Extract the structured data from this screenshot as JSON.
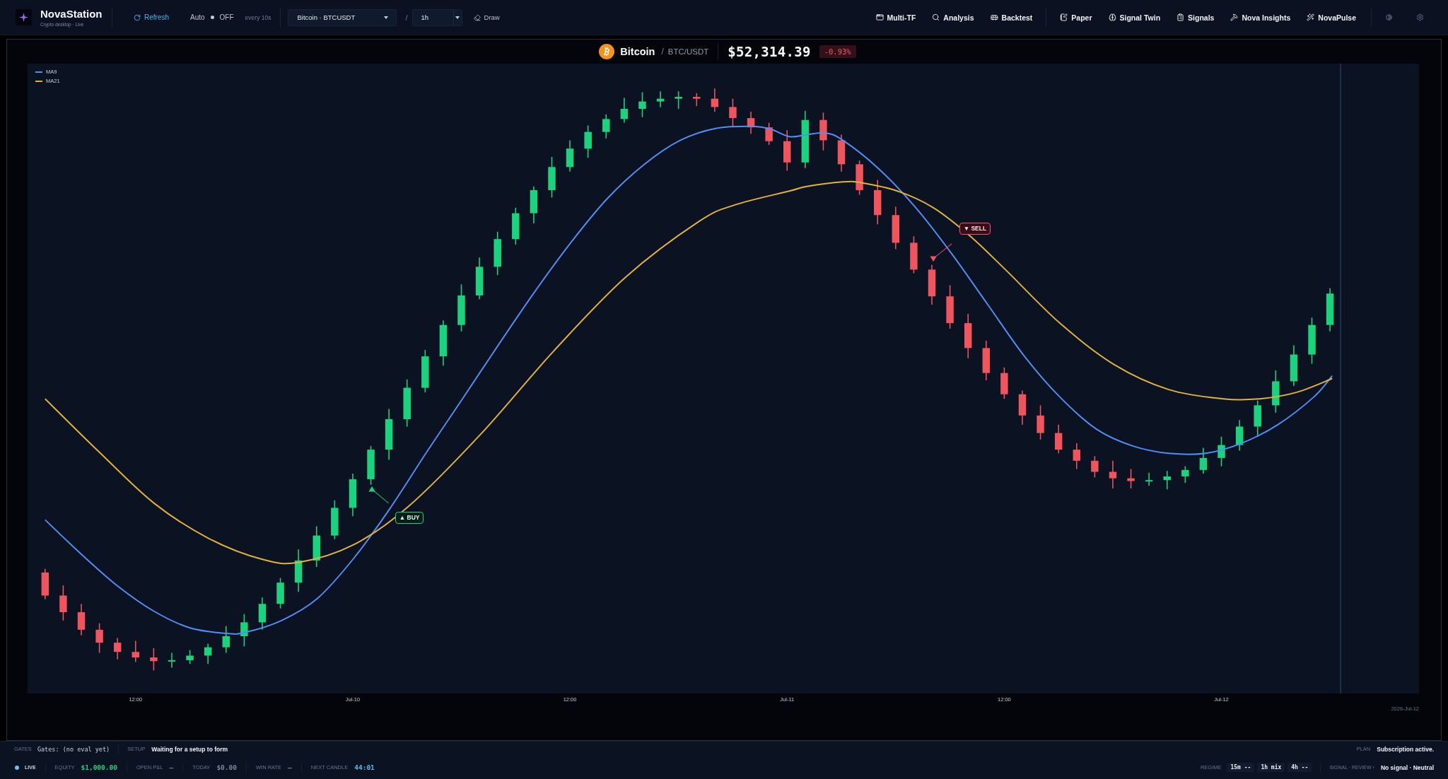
{
  "app": {
    "name": "NovaStation",
    "subtitle": "Crypto desktop · Live"
  },
  "toolbar": {
    "refresh": "Refresh",
    "auto_refresh": {
      "label": "Auto",
      "on": false,
      "state": "OFF"
    },
    "interval": "every 10s",
    "symbol_select": {
      "value": "Bitcoin · BTCUSDT"
    },
    "separator": "/",
    "timeframe_select": {
      "value": "1h"
    },
    "draw": "Draw"
  },
  "nav": {
    "groups": [
      {
        "items": [
          "Multi-TF",
          "Analysis",
          "Backtest"
        ]
      },
      {
        "items": [
          "Paper",
          "Signal Twin",
          "Signals",
          "Nova Insights",
          "NovaPulse"
        ]
      }
    ]
  },
  "header": {
    "coin": "Bitcoin",
    "separator": "/",
    "pair": "BTC/USDT",
    "price": "$52,314.39",
    "change": "-0.93%",
    "negative": true
  },
  "chart": {
    "legend": [
      {
        "label": "MA9",
        "color": "#4f8ff7"
      },
      {
        "label": "MA21",
        "color": "#e2b33c"
      }
    ],
    "signals": [
      {
        "kind": "buy",
        "label": "▲ BUY"
      },
      {
        "kind": "sell",
        "label": "▼ SELL"
      }
    ],
    "x_labels": [
      "12:00",
      "Jul-10",
      "12:00",
      "Jul-11",
      "12:00",
      "Jul-12"
    ],
    "date": "2026-Jul-12"
  },
  "status": {
    "top": {
      "gates": {
        "label": "GATES",
        "value": "Gates: (no eval yet)"
      },
      "setup": {
        "label": "SETUP",
        "value": "Waiting for a setup to form"
      },
      "plan": {
        "label": "PLAN",
        "value": "Subscription active."
      }
    },
    "bottom": {
      "live": {
        "label": "LIVE",
        "on": true
      },
      "metrics": [
        {
          "label": "EQUITY",
          "value": "$1,000.00",
          "color": "#1fd17f"
        },
        {
          "label": "OPEN P&L",
          "value": "—",
          "color": "#7d889a"
        },
        {
          "label": "TODAY",
          "value": "$0.00",
          "color": "#7d889a"
        },
        {
          "label": "WIN RATE",
          "value": "—",
          "color": "#7d889a"
        },
        {
          "label": "NEXT CANDLE",
          "value": "44:01",
          "color": "#49c0ee"
        }
      ],
      "regime": {
        "label": "REGIME",
        "chips": [
          "15m --",
          "1h mix",
          "4h --"
        ]
      },
      "signal_review": {
        "label": "SIGNAL · REVIEW ›",
        "value": "No signal · Neutral"
      }
    }
  }
}
